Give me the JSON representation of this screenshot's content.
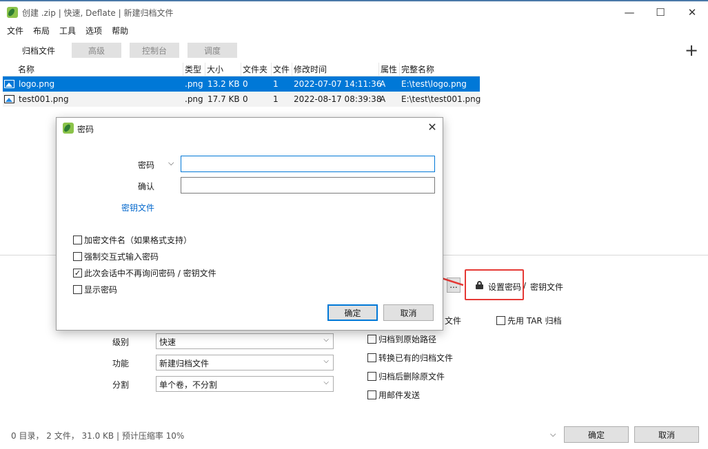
{
  "window": {
    "title": "创建 .zip | 快速, Deflate | 新建归档文件",
    "minimize": "—",
    "maximize": "☐",
    "close": "✕"
  },
  "menu": [
    "文件",
    "布局",
    "工具",
    "选项",
    "帮助"
  ],
  "tabs": [
    {
      "label": "归档文件",
      "active": true
    },
    {
      "label": "高级",
      "active": false
    },
    {
      "label": "控制台",
      "active": false
    },
    {
      "label": "调度",
      "active": false
    }
  ],
  "add_button": "+",
  "file_table": {
    "columns": [
      "名称",
      "类型",
      "大小",
      "文件夹",
      "文件",
      "修改时间",
      "属性",
      "完整名称"
    ],
    "rows": [
      {
        "name": "logo.png",
        "type": ".png",
        "size": "13.2 KB",
        "folders": "0",
        "files": "1",
        "modified": "2022-07-07 14:11:36",
        "attr": "A",
        "full": "E:\\test\\logo.png",
        "selected": true
      },
      {
        "name": "test001.png",
        "type": ".png",
        "size": "17.7 KB",
        "folders": "0",
        "files": "1",
        "modified": "2022-08-17 08:39:38",
        "attr": "A",
        "full": "E:\\test\\test001.png",
        "selected": false
      }
    ]
  },
  "settings": {
    "level_label": "级别",
    "level_value": "快速",
    "function_label": "功能",
    "function_value": "新建归档文件",
    "split_label": "分割",
    "split_value": "单个卷，不分割",
    "browse_button": "...",
    "set_password": "设置密码",
    "slash": "/",
    "key_file": "密钥文件",
    "partial_file_text": "文件",
    "tar_first": "先用 TAR 归档",
    "options": [
      {
        "label": "归档到原始路径",
        "checked": false
      },
      {
        "label": "转换已有的归档文件",
        "checked": false
      },
      {
        "label": "归档后删除原文件",
        "checked": false
      },
      {
        "label": "用邮件发送",
        "checked": false
      }
    ]
  },
  "status": {
    "text": "0 目录，  2 文件，  31.0 KB | 预计压缩率 10%"
  },
  "bottom_buttons": {
    "ok": "确定",
    "cancel": "取消"
  },
  "dialog": {
    "title": "密码",
    "password_label": "密码",
    "confirm_label": "确认",
    "password_value": "",
    "confirm_value": "",
    "key_file_link": "密钥文件",
    "checkboxes": [
      {
        "label": "加密文件名（如果格式支持）",
        "checked": false
      },
      {
        "label": "强制交互式输入密码",
        "checked": false
      },
      {
        "label": "此次会话中不再询问密码 / 密钥文件",
        "checked": true
      },
      {
        "label": "显示密码",
        "checked": false
      }
    ],
    "ok": "确定",
    "cancel": "取消"
  },
  "colors": {
    "selection": "#0078d7",
    "annotation": "#e53935",
    "link": "#0066cc"
  }
}
